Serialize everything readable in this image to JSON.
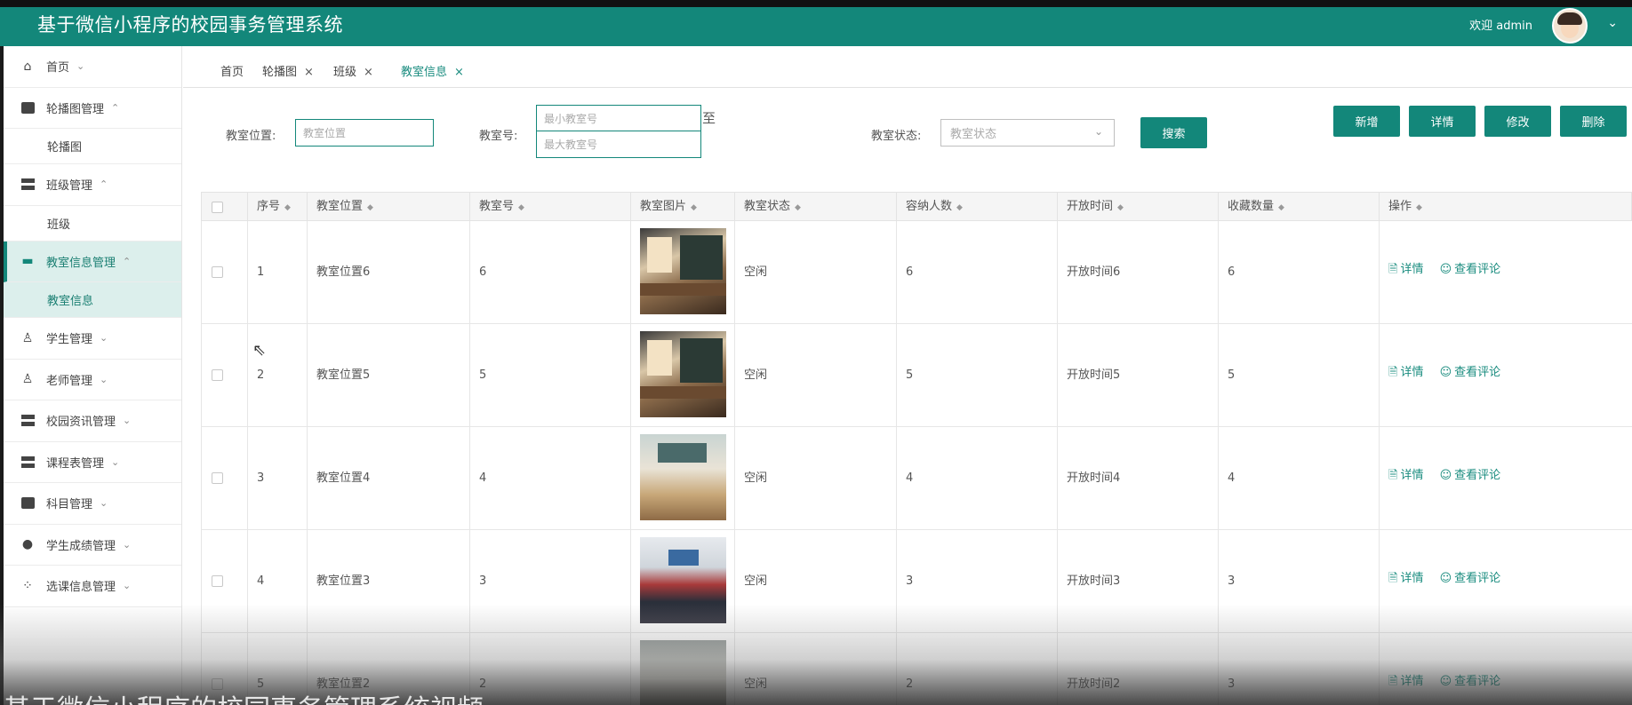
{
  "header": {
    "title": "基于微信小程序的校园事务管理系统",
    "welcome": "欢迎 admin",
    "caret": "⌄"
  },
  "sidebar": {
    "items": [
      {
        "label": "首页",
        "icon": "home-icon"
      },
      {
        "label": "轮播图管理",
        "icon": "carousel-icon"
      },
      {
        "label": "轮播图",
        "sub": true
      },
      {
        "label": "班级管理",
        "icon": "class-icon"
      },
      {
        "label": "班级",
        "sub": true
      },
      {
        "label": "教室信息管理",
        "icon": "classroom-icon",
        "active": true
      },
      {
        "label": "教室信息",
        "sub": true,
        "active": true
      },
      {
        "label": "学生管理",
        "icon": "student-icon"
      },
      {
        "label": "老师管理",
        "icon": "teacher-icon"
      },
      {
        "label": "校园资讯管理",
        "icon": "news-icon"
      },
      {
        "label": "课程表管理",
        "icon": "schedule-icon"
      },
      {
        "label": "科目管理",
        "icon": "subject-icon"
      },
      {
        "label": "学生成绩管理",
        "icon": "score-icon"
      },
      {
        "label": "选课信息管理",
        "icon": "course-select-icon"
      }
    ]
  },
  "tabs": [
    {
      "label": "首页"
    },
    {
      "label": "轮播图",
      "close": "×"
    },
    {
      "label": "班级",
      "close": "×"
    },
    {
      "label": "教室信息",
      "close": "×",
      "active": true
    }
  ],
  "filters": {
    "location_label": "教室位置:",
    "location_placeholder": "教室位置",
    "number_label": "教室号:",
    "min_placeholder": "最小教室号",
    "max_placeholder": "最大教室号",
    "range_to": "至",
    "status_label": "教室状态:",
    "status_placeholder": "教室状态",
    "search_button": "搜索"
  },
  "actions": {
    "add": "新增",
    "detail": "详情",
    "edit": "修改",
    "delete": "删除"
  },
  "table": {
    "columns": [
      "序号",
      "教室位置",
      "教室号",
      "教室图片",
      "教室状态",
      "容纳人数",
      "开放时间",
      "收藏数量",
      "操作"
    ],
    "row_actions": {
      "detail": "详情",
      "comments": "查看评论"
    },
    "rows": [
      {
        "index": "1",
        "location": "教室位置6",
        "number": "6",
        "status": "空闲",
        "capacity": "6",
        "open_time": "开放时间6",
        "favorites": "6"
      },
      {
        "index": "2",
        "location": "教室位置5",
        "number": "5",
        "status": "空闲",
        "capacity": "5",
        "open_time": "开放时间5",
        "favorites": "5"
      },
      {
        "index": "3",
        "location": "教室位置4",
        "number": "4",
        "status": "空闲",
        "capacity": "4",
        "open_time": "开放时间4",
        "favorites": "4"
      },
      {
        "index": "4",
        "location": "教室位置3",
        "number": "3",
        "status": "空闲",
        "capacity": "3",
        "open_time": "开放时间3",
        "favorites": "3"
      },
      {
        "index": "5",
        "location": "教室位置2",
        "number": "2",
        "status": "空闲",
        "capacity": "2",
        "open_time": "开放时间2",
        "favorites": "3"
      }
    ]
  },
  "colors": {
    "primary": "#13877a",
    "active_bg": "#dcefec"
  },
  "caption": "基于微信小程序的校园事务管理系统视频"
}
